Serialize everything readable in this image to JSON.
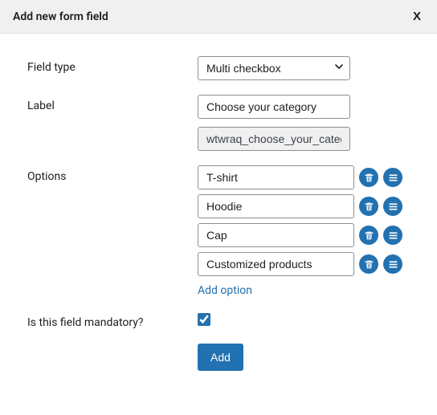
{
  "header": {
    "title": "Add new form field",
    "close": "X"
  },
  "fields": {
    "field_type": {
      "label": "Field type",
      "value": "Multi checkbox"
    },
    "label": {
      "label": "Label",
      "value": "Choose your category",
      "slug": "wtwraq_choose_your_category"
    },
    "options": {
      "label": "Options",
      "items": [
        {
          "value": "T-shirt"
        },
        {
          "value": "Hoodie"
        },
        {
          "value": "Cap"
        },
        {
          "value": "Customized products"
        }
      ],
      "add_link": "Add option"
    },
    "mandatory": {
      "label": "Is this field mandatory?",
      "checked": true
    },
    "submit": "Add"
  }
}
